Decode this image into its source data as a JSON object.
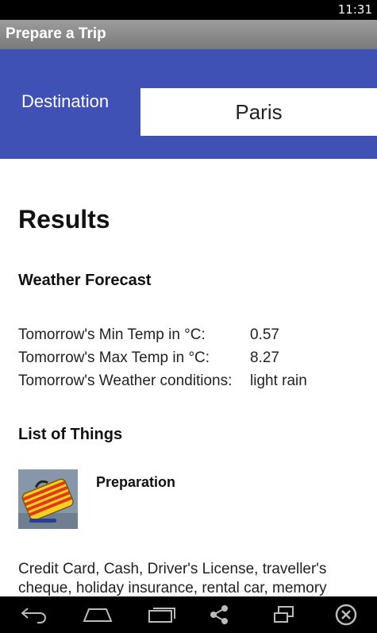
{
  "status_bar": {
    "time": "11:31"
  },
  "app": {
    "title": "Prepare a Trip"
  },
  "destination": {
    "label": "Destination",
    "value": "Paris"
  },
  "results": {
    "heading": "Results",
    "weather": {
      "heading": "Weather Forecast",
      "rows": [
        {
          "label": "Tomorrow's Min Temp in °C:",
          "value": "0.57"
        },
        {
          "label": "Tomorrow's Max Temp in °C:",
          "value": "8.27"
        },
        {
          "label": "Tomorrow's Weather conditions:",
          "value": "light rain"
        }
      ]
    },
    "things": {
      "heading": "List of Things",
      "items": [
        {
          "title": "Preparation",
          "description": "Credit Card, Cash, Driver's License, traveller's cheque, holiday insurance, rental car, memory"
        }
      ]
    }
  },
  "nav_bar": {
    "icons": [
      "back-icon",
      "home-icon",
      "recent-apps-icon",
      "share-icon",
      "screen-icon",
      "close-icon"
    ]
  },
  "colors": {
    "accent": "#3f51b5",
    "title_bar": "#8a8a8a"
  }
}
